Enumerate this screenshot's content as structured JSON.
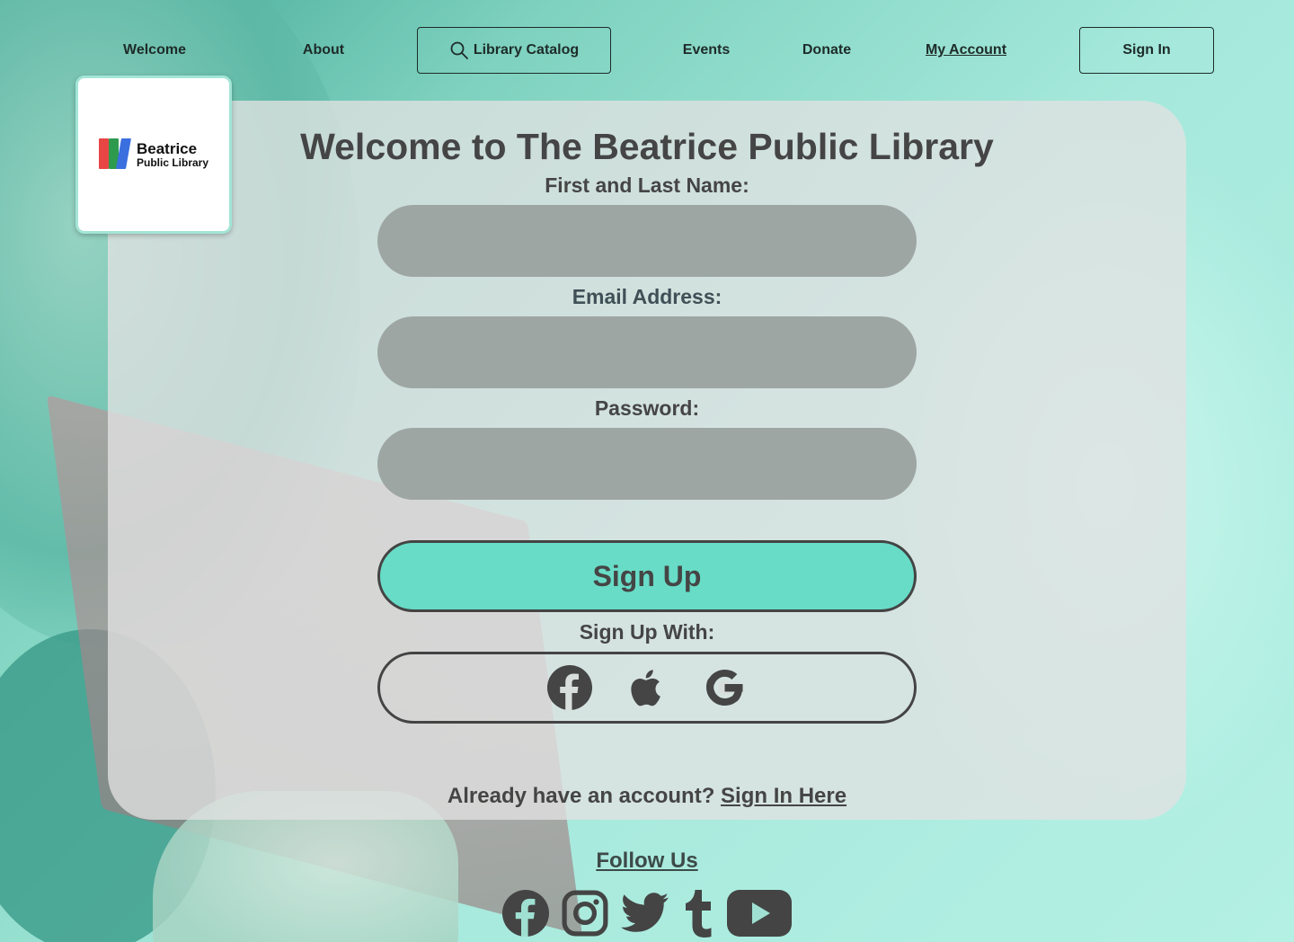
{
  "nav": {
    "welcome": "Welcome",
    "about": "About",
    "catalog": "Library Catalog",
    "events": "Events",
    "donate": "Donate",
    "account": "My Account",
    "signin": "Sign In"
  },
  "logo": {
    "line1": "Beatrice",
    "line2": "Public Library"
  },
  "page": {
    "title": "Welcome to The Beatrice Public Library"
  },
  "form": {
    "name_label": "First and Last Name:",
    "name_value": "",
    "email_label": "Email Address:",
    "email_value": "",
    "password_label": "Password:",
    "password_value": "",
    "signup_button": "Sign Up",
    "signup_with_label": "Sign Up With:",
    "providers": [
      "facebook-icon",
      "apple-icon",
      "google-icon"
    ]
  },
  "signin_prompt": {
    "text": "Already have an account?",
    "link": "Sign In Here"
  },
  "footer": {
    "follow_label": "Follow Us",
    "icons": [
      "facebook-icon",
      "instagram-icon",
      "twitter-icon",
      "tumblr-icon",
      "youtube-icon"
    ]
  },
  "colors": {
    "accent": "#68dcc7",
    "field": "#9ea6a4",
    "text": "#454545"
  }
}
